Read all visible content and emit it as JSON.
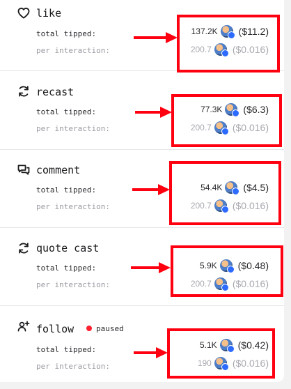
{
  "labels": {
    "total_tipped": "total tipped:",
    "per_interaction": "per interaction:"
  },
  "colors": {
    "highlight": "#ff0010",
    "paused_dot": "#ff1f2d",
    "token_badge": "#2d6bff"
  },
  "sections": [
    {
      "title": "like",
      "icon": "heart-icon",
      "total": {
        "amount": "137.2K",
        "usd": "($11.2)"
      },
      "per": {
        "amount": "200.7",
        "usd": "($0.016)"
      }
    },
    {
      "title": "recast",
      "icon": "recast-icon",
      "total": {
        "amount": "77.3K",
        "usd": "($6.3)"
      },
      "per": {
        "amount": "200.7",
        "usd": "($0.016)"
      }
    },
    {
      "title": "comment",
      "icon": "comment-icon",
      "total": {
        "amount": "54.4K",
        "usd": "($4.5)"
      },
      "per": {
        "amount": "200.7",
        "usd": "($0.016)"
      }
    },
    {
      "title": "quote cast",
      "icon": "quote-cast-icon",
      "total": {
        "amount": "5.9K",
        "usd": "($0.48)"
      },
      "per": {
        "amount": "200.7",
        "usd": "($0.016)"
      }
    },
    {
      "title": "follow",
      "icon": "add-user-icon",
      "status": "paused",
      "total": {
        "amount": "5.1K",
        "usd": "($0.42)"
      },
      "per": {
        "amount": "190",
        "usd": "($0.016)"
      }
    }
  ]
}
